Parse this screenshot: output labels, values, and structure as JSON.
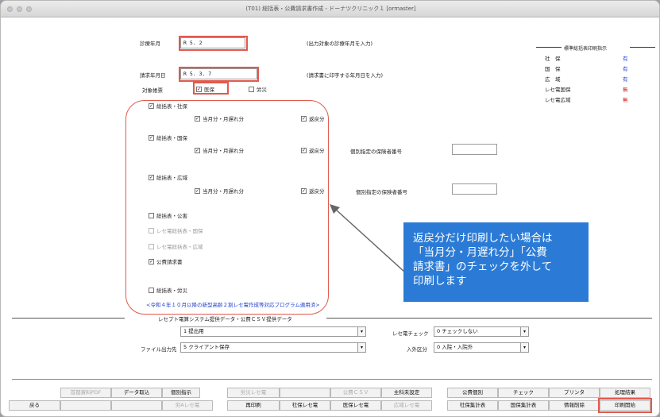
{
  "window": {
    "title": "(T01) 総括表・公費請求書作成 - ドーナツクリニック１ [ormaster]"
  },
  "form": {
    "shinryo_label": "診療年月",
    "shinryo_value": "R 5. 2",
    "shinryo_note": "(出力対象の診療年月を入力)",
    "seikyu_label": "請求年月日",
    "seikyu_value": "R 5. 3. 7",
    "seikyu_note": "(請求書に印字する年月日を入力)",
    "taisho_label": "対象帳票",
    "iho_label": "医保",
    "rousai_label": "労災"
  },
  "panel": {
    "title": "標準総括表印刷指示",
    "rows": [
      {
        "label": "社　保",
        "value": "有",
        "color": "#1f3fd0"
      },
      {
        "label": "国　保",
        "value": "有",
        "color": "#1f3fd0"
      },
      {
        "label": "広　域",
        "value": "有",
        "color": "#1f3fd0"
      },
      {
        "label": "レセ電国保",
        "value": "無",
        "color": "#d02020"
      },
      {
        "label": "レセ電広域",
        "value": "無",
        "color": "#d02020"
      }
    ]
  },
  "checks": {
    "shaho": "総括表・社保",
    "kokuho": "総括表・国保",
    "kouiki": "総括表・広域",
    "tougetsu": "当月分・月遅れ分",
    "henrei": "返戻分",
    "kobetsu": "個別指定の保険者番号",
    "kouhi": "総括表・公害",
    "resaden_kokuho": "レセ電総括表・国保",
    "resaden_kouiki": "レセ電総括表・広域",
    "kouhi_seikyu": "公費請求書",
    "rousai": "総括表・労災"
  },
  "notice": "<令和４年１０月以降の新型高齢２割レセ電作成等対応プログラム適用済>",
  "csv": {
    "header": "レセプト電算システム提供データ・公費ＣＳＶ提供データ",
    "select1": "1 提出用",
    "file_label": "ファイル出力先",
    "file_value": "5 クライアント保存",
    "check_label": "レセ電チェック",
    "check_value": "0 チェックしない",
    "nyugai_label": "入外区分",
    "nyugai_value": "0 入院・入院外"
  },
  "callout": {
    "line1": "返戻分だけ印刷したい場合は",
    "line2": "「当月分・月遅れ分」「公費",
    "line3": "請求書」のチェックを外して",
    "line4": "印刷します"
  },
  "buttons": {
    "b01": "戻る",
    "b02": "",
    "b03": "",
    "b04": "",
    "b05": "",
    "b06": "再印刷",
    "b07": "社保レセ電",
    "b08": "医保レセ電",
    "b09": "広域レセ電",
    "b10": "社保集計表",
    "b11": "国保集計表",
    "b12": "情報削除",
    "b13": "印刷開始",
    "t01": "首都資料PDF",
    "t02": "データ取込",
    "t03": "個別指示",
    "t05": "労災レセ電",
    "t07": "公費ＣＳＶ",
    "t08": "主科未設定",
    "t09": "公費個別",
    "t10": "チェック",
    "t11": "プリンタ",
    "t12": "処理結果",
    "t04b": "労Aレセ電"
  }
}
